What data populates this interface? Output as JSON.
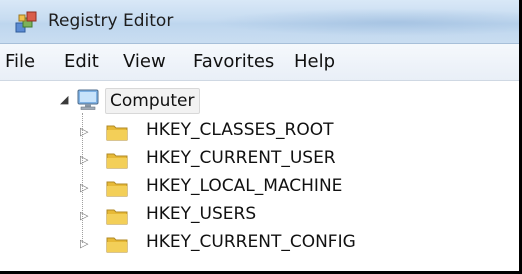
{
  "window": {
    "title": "Registry Editor"
  },
  "menu": [
    "File",
    "Edit",
    "View",
    "Favorites",
    "Help"
  ],
  "tree": {
    "root": {
      "label": "Computer",
      "icon": "computer-icon",
      "expanded": true
    },
    "children": [
      {
        "label": "HKEY_CLASSES_ROOT",
        "icon": "folder-icon"
      },
      {
        "label": "HKEY_CURRENT_USER",
        "icon": "folder-icon"
      },
      {
        "label": "HKEY_LOCAL_MACHINE",
        "icon": "folder-icon"
      },
      {
        "label": "HKEY_USERS",
        "icon": "folder-icon"
      },
      {
        "label": "HKEY_CURRENT_CONFIG",
        "icon": "folder-icon"
      }
    ]
  },
  "colors": {
    "titlebar": "#c7dcf1",
    "menubar": "#e9eff7",
    "folder": "#e7b936",
    "background": "#ffffff"
  }
}
